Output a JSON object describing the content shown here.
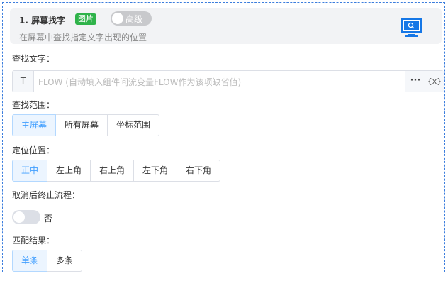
{
  "header": {
    "title": "1. 屏幕找字",
    "badge": "图片",
    "advanced_toggle_label": "高级",
    "advanced_toggle_on": false,
    "subtitle": "在屏幕中查找指定文字出现的位置",
    "icon": "screen-search-icon"
  },
  "find_text": {
    "label": "查找文字：",
    "prefix": "T",
    "value": "",
    "placeholder": "FLOW (自动填入组件间流变量FLOW作为该项缺省值)",
    "more_label": "···",
    "variable_label": "{x}"
  },
  "search_range": {
    "label": "查找范围：",
    "options": [
      "主屏幕",
      "所有屏幕",
      "坐标范围"
    ],
    "selected": "主屏幕"
  },
  "position": {
    "label": "定位位置：",
    "options": [
      "正中",
      "左上角",
      "右上角",
      "左下角",
      "右下角"
    ],
    "selected": "正中"
  },
  "stop_on_cancel": {
    "label": "取消后终止流程：",
    "value_label": "否",
    "on": false
  },
  "match_result": {
    "label": "匹配结果：",
    "options": [
      "单条",
      "多条"
    ],
    "selected": "单条"
  },
  "colors": {
    "accent": "#409eff",
    "badge_green": "#2fb34a",
    "border_dashed": "#3b7ddd",
    "icon_blue": "#1677e6"
  }
}
